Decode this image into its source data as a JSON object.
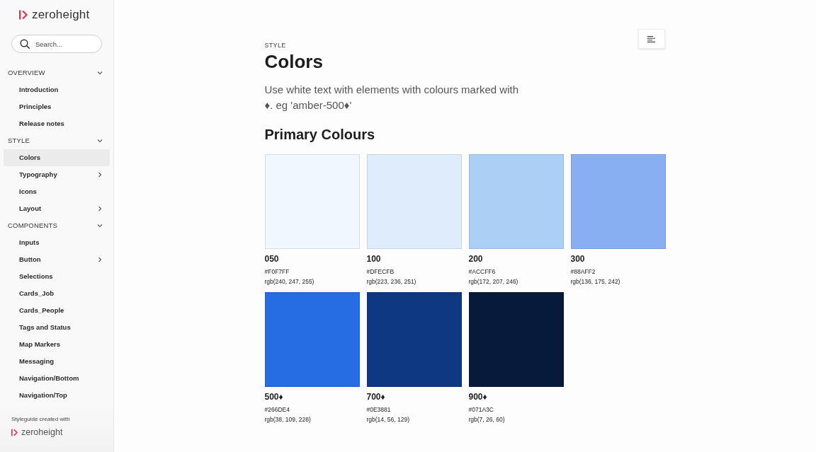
{
  "sidebar": {
    "logo": {
      "text": "zeroheight"
    },
    "search": {
      "placeholder": "Search..."
    },
    "sections": [
      {
        "title": "OVERVIEW",
        "expanded": true,
        "items": [
          {
            "label": "Introduction",
            "kind": "page",
            "selected": false
          },
          {
            "label": "Principles",
            "kind": "page",
            "selected": false
          },
          {
            "label": "Release notes",
            "kind": "page",
            "selected": false
          }
        ]
      },
      {
        "title": "STYLE",
        "expanded": true,
        "items": [
          {
            "label": "Colors",
            "kind": "page",
            "selected": true
          },
          {
            "label": "Typography",
            "kind": "group",
            "expanded": false,
            "selected": false
          },
          {
            "label": "Icons",
            "kind": "page",
            "selected": false
          },
          {
            "label": "Layout",
            "kind": "group",
            "expanded": false,
            "selected": false
          }
        ]
      },
      {
        "title": "COMPONENTS",
        "expanded": true,
        "items": [
          {
            "label": "Inputs",
            "kind": "page",
            "selected": false
          },
          {
            "label": "Button",
            "kind": "group",
            "expanded": false,
            "selected": false
          },
          {
            "label": "Selections",
            "kind": "page",
            "selected": false
          },
          {
            "label": "Cards_Job",
            "kind": "page",
            "selected": false
          },
          {
            "label": "Cards_People",
            "kind": "page",
            "selected": false
          },
          {
            "label": "Tags and Status",
            "kind": "page",
            "selected": false
          },
          {
            "label": "Map Markers",
            "kind": "page",
            "selected": false
          },
          {
            "label": "Messaging",
            "kind": "page",
            "selected": false
          },
          {
            "label": "Navigation/Bottom",
            "kind": "page",
            "selected": false
          },
          {
            "label": "Navigation/Top",
            "kind": "page",
            "selected": false
          }
        ]
      }
    ],
    "footer": {
      "caption": "Styleguide created with",
      "logo_text": "zeroheight"
    }
  },
  "page": {
    "eyebrow": "STYLE",
    "title": "Colors",
    "description": "Use white text with elements with colours marked with ♦. eg 'amber-500♦'",
    "sections": [
      {
        "title": "Primary Colours",
        "swatches": [
          {
            "name": "050",
            "hex": "#F0F7FF",
            "rgb": "rgb(240, 247, 255)",
            "color": "#f0f7ff"
          },
          {
            "name": "100",
            "hex": "#DFECFB",
            "rgb": "rgb(223, 236, 251)",
            "color": "#dfecfb"
          },
          {
            "name": "200",
            "hex": "#ACCFF6",
            "rgb": "rgb(172, 207, 246)",
            "color": "#accff6"
          },
          {
            "name": "300",
            "hex": "#88AFF2",
            "rgb": "rgb(136, 175, 242)",
            "color": "#88aff2"
          },
          {
            "name": "500♦",
            "hex": "#266DE4",
            "rgb": "rgb(38, 109, 228)",
            "color": "#266de4"
          },
          {
            "name": "700♦",
            "hex": "#0E3881",
            "rgb": "rgb(14, 56, 129)",
            "color": "#0e3881"
          },
          {
            "name": "900♦",
            "hex": "#071A3C",
            "rgb": "rgb(7, 26, 60)",
            "color": "#071a3c"
          }
        ]
      }
    ]
  }
}
